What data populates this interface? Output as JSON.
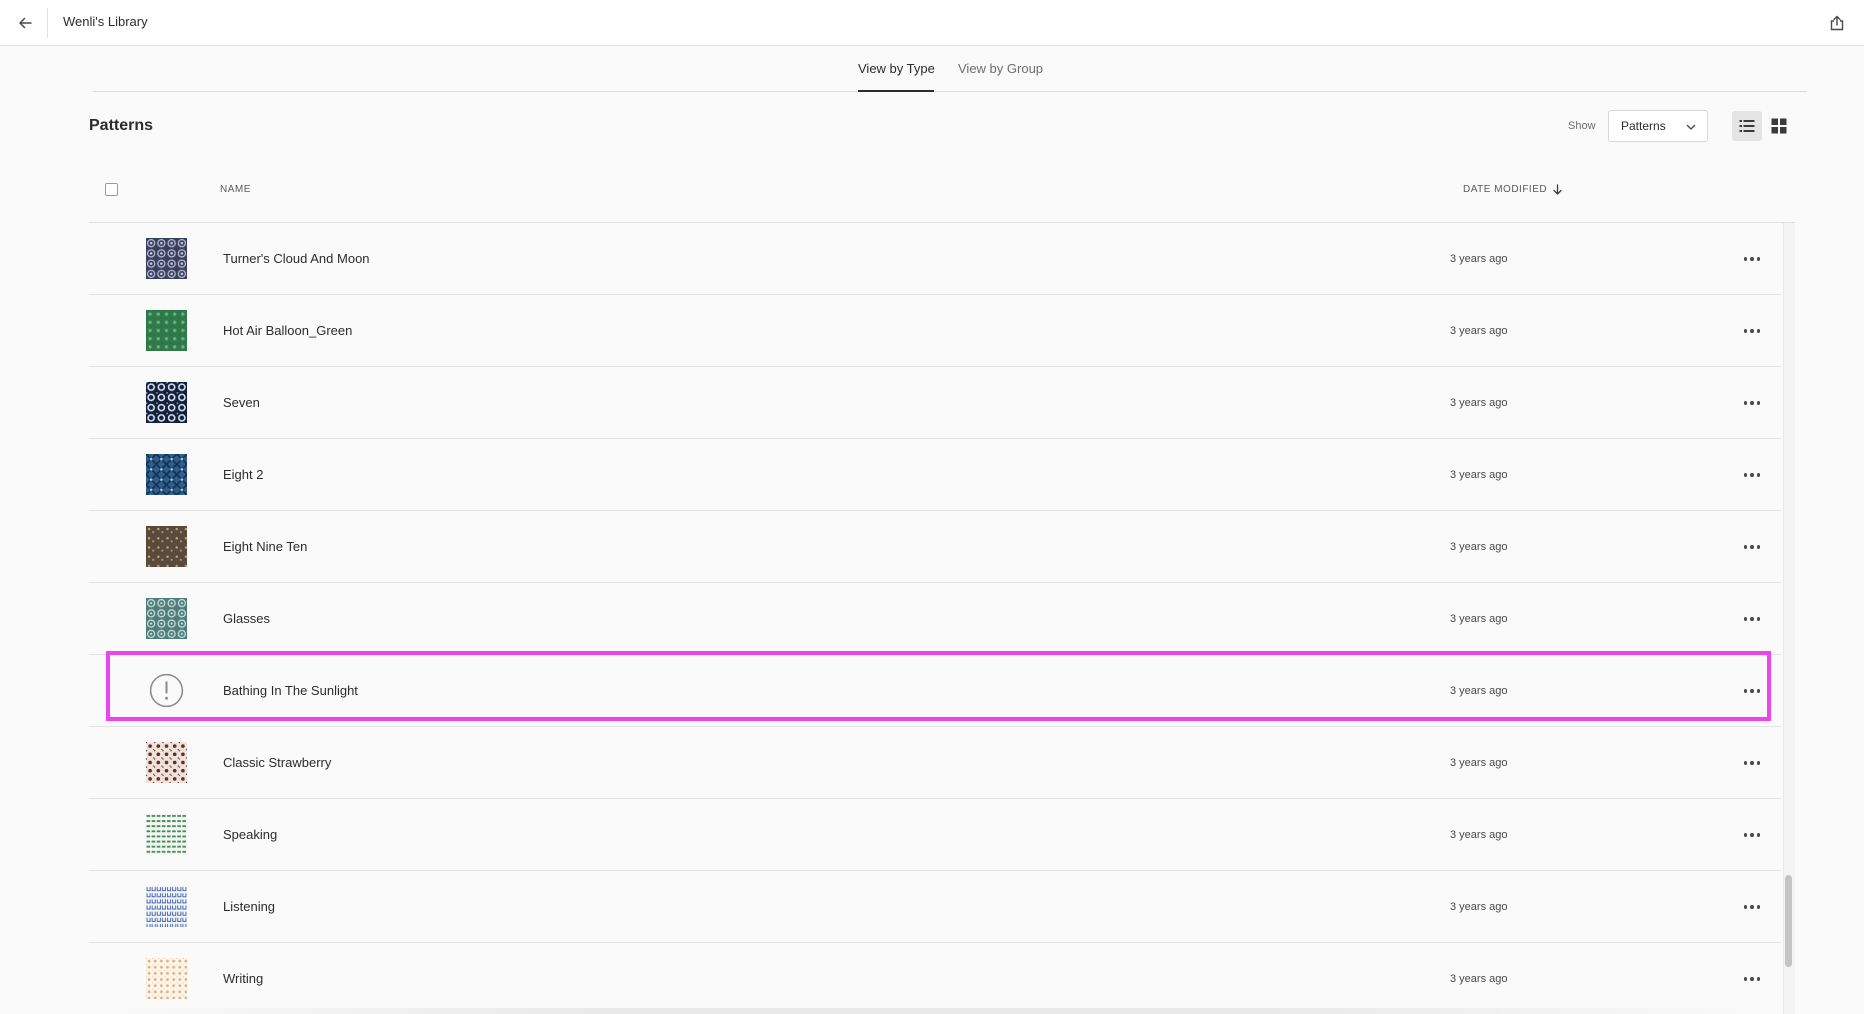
{
  "topbar": {
    "title": "Wenli's Library",
    "back_icon": "arrow-left-icon",
    "share_icon": "share-export-icon"
  },
  "tabs": [
    {
      "label": "View by Type",
      "active": true
    },
    {
      "label": "View by Group",
      "active": false
    }
  ],
  "section": {
    "title": "Patterns"
  },
  "filter": {
    "show_label": "Show",
    "selected": "Patterns"
  },
  "view_modes": [
    "list-view-icon",
    "grid-view-icon"
  ],
  "table": {
    "columns": {
      "name": "NAME",
      "date": "DATE MODIFIED"
    },
    "sort_icon": "arrow-down-icon",
    "rows": [
      {
        "name": "Turner's Cloud And Moon",
        "date": "3 years ago"
      },
      {
        "name": "Hot Air Balloon_Green",
        "date": "3 years ago"
      },
      {
        "name": "Seven",
        "date": "3 years ago"
      },
      {
        "name": "Eight 2",
        "date": "3 years ago"
      },
      {
        "name": "Eight Nine Ten",
        "date": "3 years ago"
      },
      {
        "name": "Glasses",
        "date": "3 years ago"
      },
      {
        "name": "Bathing In The Sunlight",
        "date": "3 years ago"
      },
      {
        "name": "Classic Strawberry",
        "date": "3 years ago"
      },
      {
        "name": "Speaking",
        "date": "3 years ago"
      },
      {
        "name": "Listening",
        "date": "3 years ago"
      },
      {
        "name": "Writing",
        "date": "3 years ago"
      }
    ]
  },
  "colors": {
    "highlight": "#ee44ee",
    "background": "#fafafa"
  }
}
